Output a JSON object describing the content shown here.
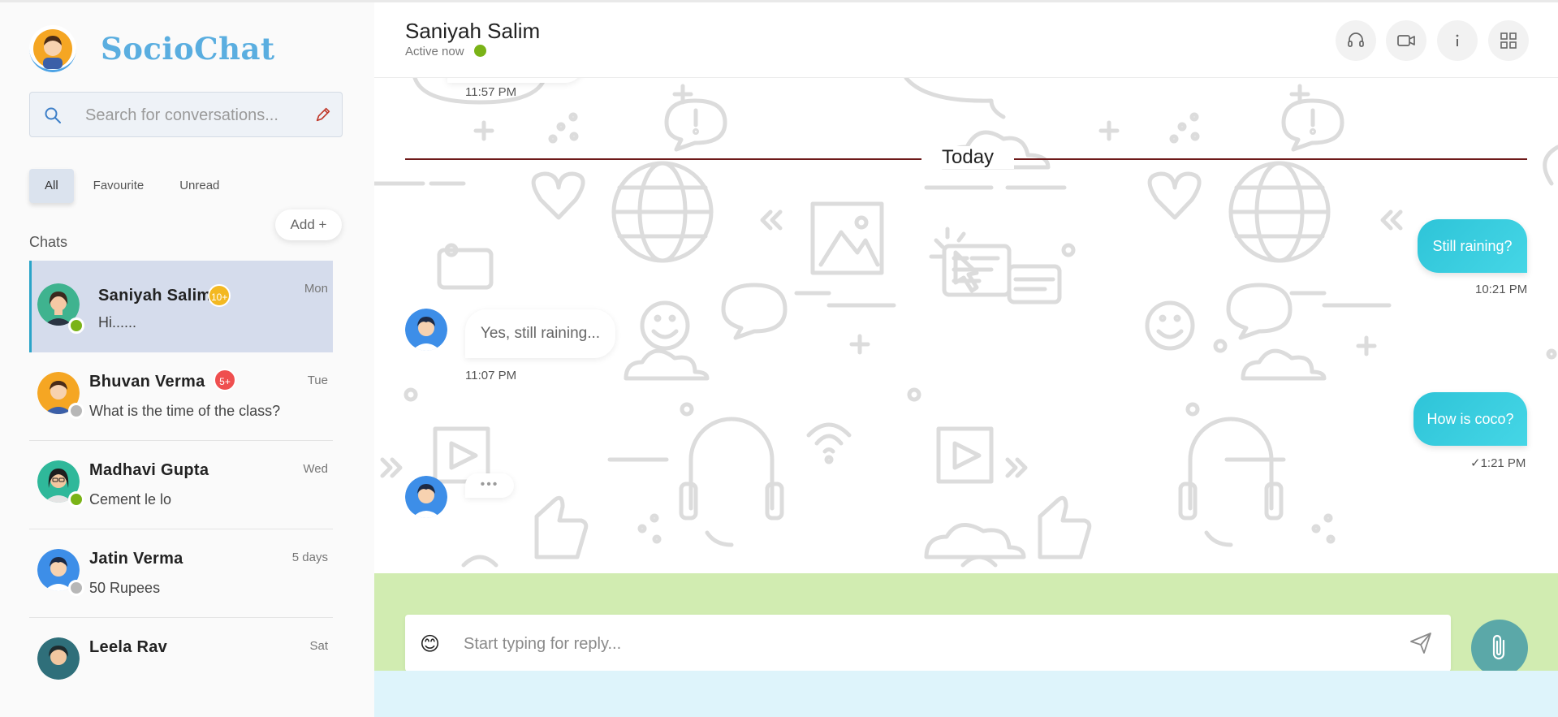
{
  "app": {
    "name": "SocioChat"
  },
  "search": {
    "placeholder": "Search for conversations..."
  },
  "filters": {
    "tabs": [
      "All",
      "Favourite",
      "Unread"
    ],
    "active": "All"
  },
  "add_button": {
    "label": "Add +"
  },
  "chats_label": "Chats",
  "chats": [
    {
      "name": "Saniyah Salim",
      "last_message": "Hi......",
      "time": "Mon",
      "badge": "10+",
      "badge_color": "#f3b820",
      "status": "online",
      "status_color": "#7ab317",
      "avatar_bg": "#3fb38f",
      "hair_color": "#3b2a1e",
      "active": true
    },
    {
      "name": "Bhuvan Verma",
      "last_message": "What is the time of the class?",
      "time": "Tue",
      "badge": "5+",
      "badge_color": "#ef4f4f",
      "status": "offline",
      "status_color": "#b7b7b7",
      "avatar_bg": "#f5a623",
      "hair_color": "#4a2c18",
      "active": false
    },
    {
      "name": "Madhavi Gupta",
      "last_message": "Cement le lo",
      "time": "Wed",
      "badge": "",
      "status": "online",
      "status_color": "#7ab317",
      "avatar_bg": "#2fb89a",
      "hair_color": "#1e1e1e",
      "active": false
    },
    {
      "name": "Jatin Verma",
      "last_message": "50 Rupees",
      "time": "5 days",
      "badge": "",
      "status": "offline",
      "status_color": "#b7b7b7",
      "avatar_bg": "#3d8ee8",
      "hair_color": "#1d2a44",
      "active": false
    },
    {
      "name": "Leela Rav",
      "last_message": "",
      "time": "Sat",
      "badge": "",
      "status": "",
      "status_color": "#b7b7b7",
      "avatar_bg": "#2f6f7a",
      "hair_color": "#1e2b2e",
      "active": false
    }
  ],
  "conversation": {
    "contact_name": "Saniyah Salim",
    "status_text": "Active now",
    "status_color": "#7ab317",
    "header_icons": [
      "headset-icon",
      "video-camera-icon",
      "info-icon",
      "grid-icon"
    ],
    "prev_message_time": "11:57 PM",
    "day_divider": "Today",
    "messages": [
      {
        "direction": "out",
        "text": "Still raining?",
        "time": "10:21 PM"
      },
      {
        "direction": "in",
        "text": "Yes, still raining...",
        "time": "11:07 PM"
      },
      {
        "direction": "out",
        "text": "How is coco?",
        "time": "✓1:21 PM"
      },
      {
        "direction": "in",
        "typing": true,
        "text": "•••"
      }
    ]
  },
  "composer": {
    "placeholder": "Start typing for reply...",
    "emoji": "😊"
  },
  "colors": {
    "brand": "#5aaee0",
    "bubble_out": "#2ec4d8",
    "composer_band": "#d1ecb1",
    "divider_line": "#6e1a1a",
    "attach_button": "#5ba8a8"
  }
}
